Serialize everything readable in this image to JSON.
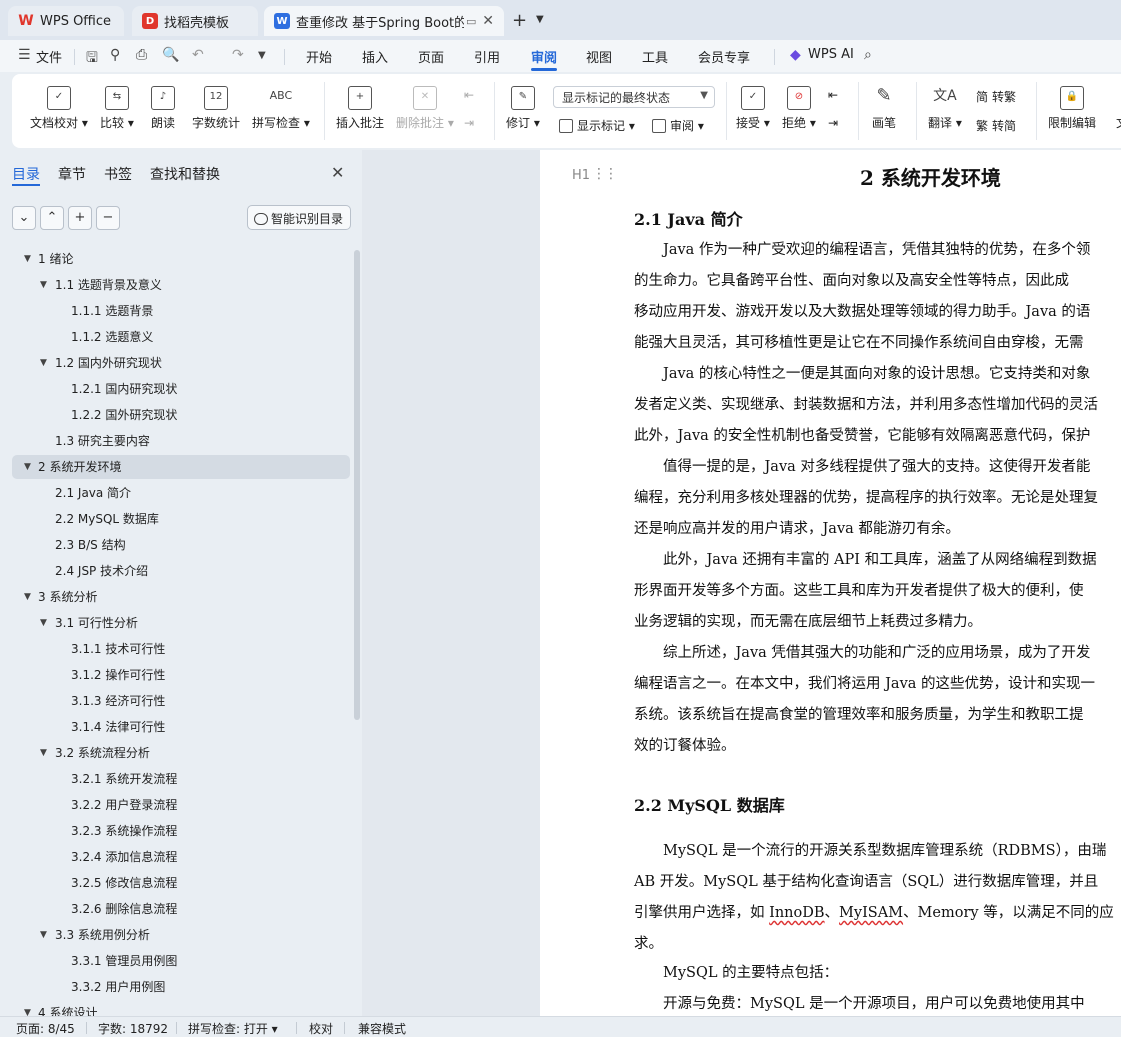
{
  "tabs": {
    "wps": "WPS Office",
    "templates": "找稻壳模板",
    "document": "查重修改 基于Spring Boot的"
  },
  "menu": [
    "文件",
    "开始",
    "插入",
    "页面",
    "引用",
    "审阅",
    "视图",
    "工具",
    "会员专享",
    "WPS AI"
  ],
  "menu_active": "审阅",
  "ribbon": {
    "doc_check": "文档校对",
    "compare": "比较",
    "read_aloud": "朗读",
    "word_count": "字数统计",
    "spell_check": "拼写检查",
    "insert_comment": "插入批注",
    "delete_comment": "删除批注",
    "revise": "修订",
    "show_markup": "显示标记",
    "review": "审阅",
    "markup_select": "显示标记的最终状态",
    "accept": "接受",
    "reject": "拒绝",
    "pen": "画笔",
    "translate": "翻译",
    "to_traditional": "转繁",
    "to_simplified": "转简",
    "restrict_edit": "限制编辑",
    "more_cut": "文"
  },
  "nav": {
    "tabs": [
      "目录",
      "章节",
      "书签",
      "查找和替换"
    ],
    "smart_toc": "智能识别目录",
    "toc": [
      {
        "label": "1  绪论",
        "level": 1,
        "expanded": true
      },
      {
        "label": "1.1 选题背景及意义",
        "level": 2,
        "expanded": true
      },
      {
        "label": "1.1.1 选题背景",
        "level": 3
      },
      {
        "label": "1.1.2 选题意义",
        "level": 3
      },
      {
        "label": "1.2  国内外研究现状",
        "level": 2,
        "expanded": true
      },
      {
        "label": "1.2.1 国内研究现状",
        "level": 3
      },
      {
        "label": "1.2.2 国外研究现状",
        "level": 3
      },
      {
        "label": "1.3  研究主要内容",
        "level": 2
      },
      {
        "label": "2  系统开发环境",
        "level": 1,
        "expanded": true,
        "selected": true
      },
      {
        "label": "2.1 Java 简介",
        "level": 2
      },
      {
        "label": "2.2 MySQL 数据库",
        "level": 2
      },
      {
        "label": "2.3 B/S 结构",
        "level": 2
      },
      {
        "label": "2.4 JSP 技术介绍",
        "level": 2
      },
      {
        "label": "3  系统分析",
        "level": 1,
        "expanded": true
      },
      {
        "label": "3.1  可行性分析",
        "level": 2,
        "expanded": true
      },
      {
        "label": "3.1.1  技术可行性",
        "level": 3
      },
      {
        "label": "3.1.2 操作可行性",
        "level": 3
      },
      {
        "label": "3.1.3  经济可行性",
        "level": 3
      },
      {
        "label": "3.1.4  法律可行性",
        "level": 3
      },
      {
        "label": "3.2 系统流程分析",
        "level": 2,
        "expanded": true
      },
      {
        "label": "3.2.1 系统开发流程",
        "level": 3
      },
      {
        "label": "3.2.2  用户登录流程",
        "level": 3
      },
      {
        "label": "3.2.3  系统操作流程",
        "level": 3
      },
      {
        "label": "3.2.4  添加信息流程",
        "level": 3
      },
      {
        "label": "3.2.5  修改信息流程",
        "level": 3
      },
      {
        "label": "3.2.6  删除信息流程",
        "level": 3
      },
      {
        "label": "3.3 系统用例分析",
        "level": 2,
        "expanded": true
      },
      {
        "label": "3.3.1 管理员用例图",
        "level": 3
      },
      {
        "label": "3.3.2 用户用例图",
        "level": 3
      },
      {
        "label": "4  系统设计",
        "level": 1,
        "expanded": true
      }
    ]
  },
  "document": {
    "heading_mark": "H1",
    "h1": "2  系统开发环境",
    "sec1_title": "2.1 Java 简介",
    "sec1_lines": [
      "　　Java 作为一种广受欢迎的编程语言，凭借其独特的优势，在多个领",
      "的生命力。它具备跨平台性、面向对象以及高安全性等特点，因此成",
      "移动应用开发、游戏开发以及大数据处理等领域的得力助手。Java 的语",
      "能强大且灵活，其可移植性更是让它在不同操作系统间自由穿梭，无需",
      "　　Java 的核心特性之一便是其面向对象的设计思想。它支持类和对象",
      "发者定义类、实现继承、封装数据和方法，并利用多态性增加代码的灵活",
      "此外，Java 的安全性机制也备受赞誉，它能够有效隔离恶意代码，保护",
      "　　值得一提的是，Java 对多线程提供了强大的支持。这使得开发者能",
      "编程，充分利用多核处理器的优势，提高程序的执行效率。无论是处理复",
      "还是响应高并发的用户请求，Java 都能游刃有余。",
      "　　此外，Java 还拥有丰富的 API 和工具库，涵盖了从网络编程到数据",
      "形界面开发等多个方面。这些工具和库为开发者提供了极大的便利，使",
      "业务逻辑的实现，而无需在底层细节上耗费过多精力。",
      "　　综上所述，Java 凭借其强大的功能和广泛的应用场景，成为了开发",
      "编程语言之一。在本文中，我们将运用 Java 的这些优势，设计和实现一",
      "系统。该系统旨在提高食堂的管理效率和服务质量，为学生和教职工提",
      "效的订餐体验。"
    ],
    "sec2_title": "2.2 MySQL 数据库",
    "sec2_line1": "　　MySQL 是一个流行的开源关系型数据库管理系统（RDBMS），由瑞",
    "sec2_line2": "AB 开发。MySQL 基于结构化查询语言（SQL）进行数据库管理，并且",
    "sec2_line3_a": "引擎供用户选择，如 ",
    "sec2_line3_innodb": "InnoDB",
    "sec2_line3_b": "、",
    "sec2_line3_myisam": "MyISAM",
    "sec2_line3_c": "、Memory 等，以满足不同的应",
    "sec2_line4": "求。",
    "sec2_line5": "　　MySQL 的主要特点包括：",
    "sec2_line6": "　　开源与免费：MySQL 是一个开源项目，用户可以免费地使用其中"
  },
  "status": {
    "page": "页面: 8/45",
    "words": "字数: 18792",
    "spell": "拼写检查: 打开",
    "proof": "校对",
    "compat": "兼容模式"
  },
  "colors": {
    "accent": "#2468d8",
    "wps_red": "#e0362c",
    "writer_blue": "#2f6fe0"
  }
}
